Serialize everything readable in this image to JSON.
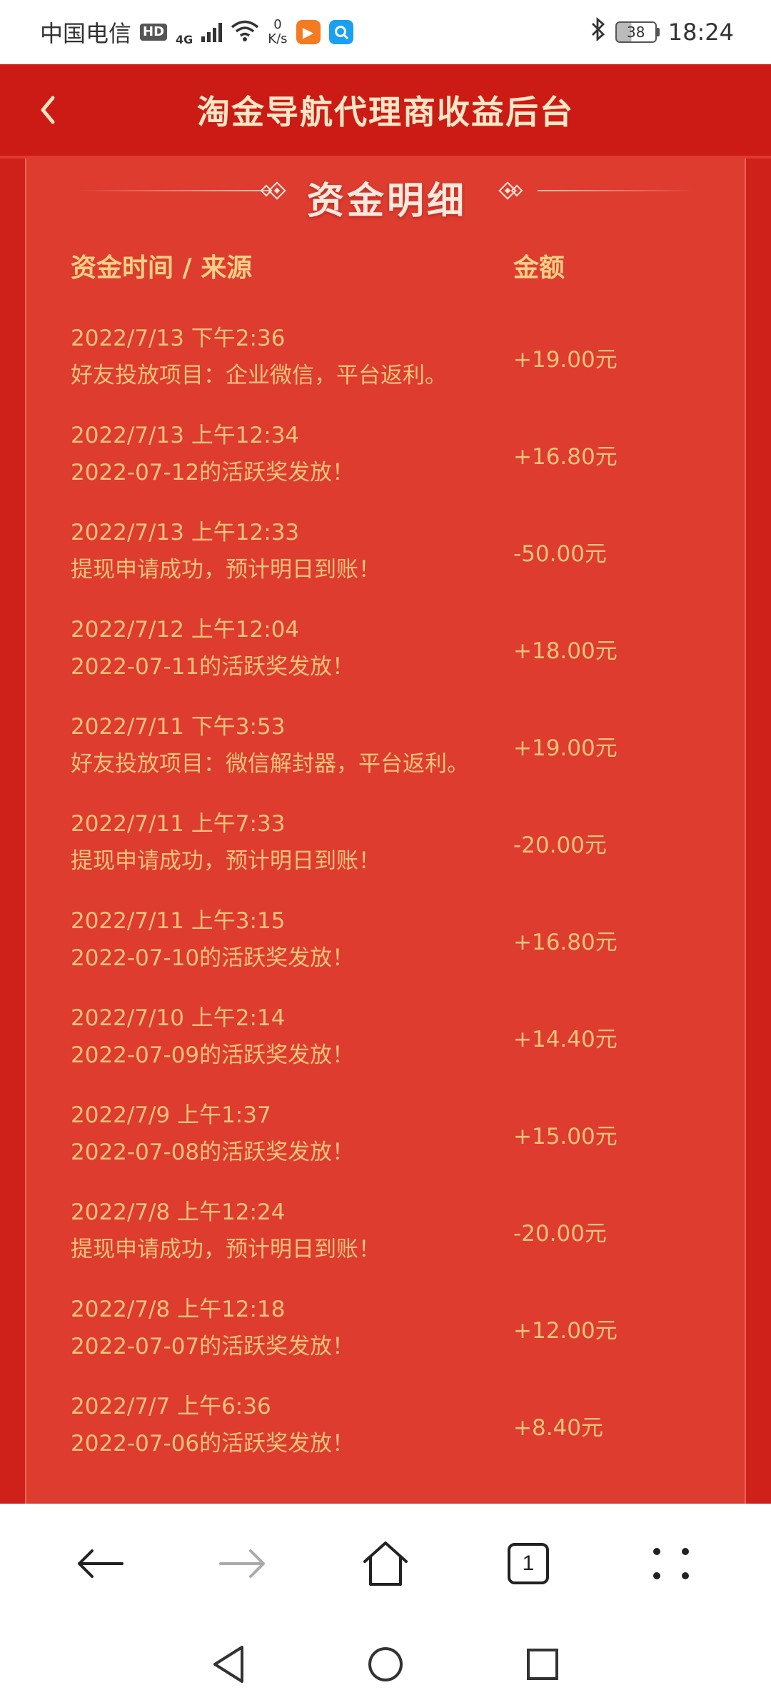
{
  "status_bar": {
    "carrier": "中国电信",
    "hd": "HD",
    "network": "4G",
    "speed_value": "0",
    "speed_unit": "K/s",
    "battery": "38",
    "time": "18:24"
  },
  "header": {
    "title": "淘金导航代理商收益后台"
  },
  "section": {
    "title": "资金明细",
    "col_time": "资金时间 / 来源",
    "col_amount": "金额"
  },
  "rows": [
    {
      "time": "2022/7/13 下午2:36",
      "source": "好友投放项目：企业微信，平台返利。",
      "amount": "+19.00元"
    },
    {
      "time": "2022/7/13 上午12:34",
      "source": "2022-07-12的活跃奖发放！",
      "amount": "+16.80元"
    },
    {
      "time": "2022/7/13 上午12:33",
      "source": "提现申请成功，预计明日到账！",
      "amount": "-50.00元"
    },
    {
      "time": "2022/7/12 上午12:04",
      "source": "2022-07-11的活跃奖发放！",
      "amount": "+18.00元"
    },
    {
      "time": "2022/7/11 下午3:53",
      "source": "好友投放项目：微信解封器，平台返利。",
      "amount": "+19.00元"
    },
    {
      "time": "2022/7/11 上午7:33",
      "source": "提现申请成功，预计明日到账！",
      "amount": "-20.00元"
    },
    {
      "time": "2022/7/11 上午3:15",
      "source": "2022-07-10的活跃奖发放！",
      "amount": "+16.80元"
    },
    {
      "time": "2022/7/10 上午2:14",
      "source": "2022-07-09的活跃奖发放！",
      "amount": "+14.40元"
    },
    {
      "time": "2022/7/9 上午1:37",
      "source": "2022-07-08的活跃奖发放！",
      "amount": "+15.00元"
    },
    {
      "time": "2022/7/8 上午12:24",
      "source": "提现申请成功，预计明日到账！",
      "amount": "-20.00元"
    },
    {
      "time": "2022/7/8 上午12:18",
      "source": "2022-07-07的活跃奖发放！",
      "amount": "+12.00元"
    },
    {
      "time": "2022/7/7 上午6:36",
      "source": "2022-07-06的活跃奖发放！",
      "amount": "+8.40元"
    }
  ],
  "browser": {
    "tab_count": "1"
  }
}
